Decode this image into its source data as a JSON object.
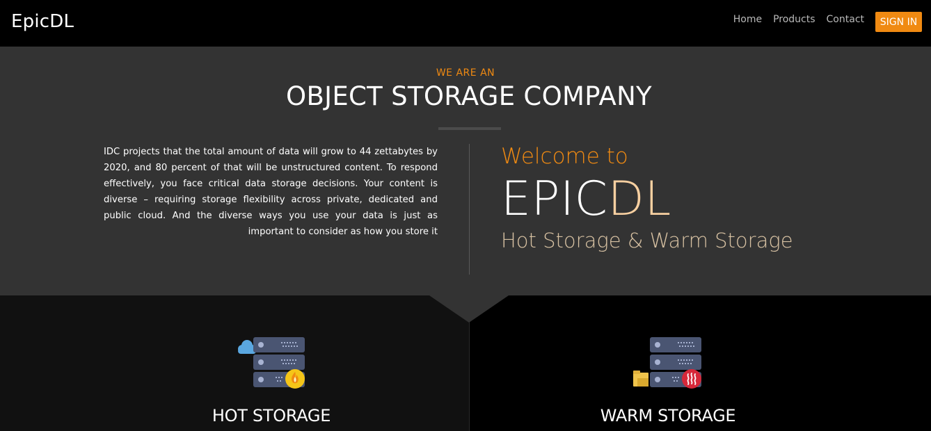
{
  "nav": {
    "brand": "EpicDL",
    "links": [
      "Home",
      "Products",
      "Contact"
    ],
    "signin": "SIGN IN"
  },
  "hero": {
    "eyebrow": "WE ARE AN",
    "headline": "OBJECT STORAGE COMPANY",
    "intro": "IDC projects that the total amount of data will grow to 44 zettabytes by 2020, and 80 percent of that will be unstructured content. To respond effectively, you face critical data storage decisions. Your content is diverse – requiring storage flexibility across private, dedicated and public cloud. And the diverse ways you use your data is just as important to consider as how you store it",
    "welcome": "Welcome to",
    "brand_white": "EPIC",
    "brand_orange": "DL",
    "tagline": "Hot Storage & Warm Storage"
  },
  "features": {
    "hot": {
      "title": "HOT STORAGE",
      "icon": "hot-storage-server-icon"
    },
    "warm": {
      "title": "WARM STORAGE",
      "icon": "warm-storage-server-icon"
    }
  },
  "colors": {
    "accent": "#f08a12",
    "hero_bg": "#333333",
    "brand_orange_light": "#f8d0a1"
  }
}
